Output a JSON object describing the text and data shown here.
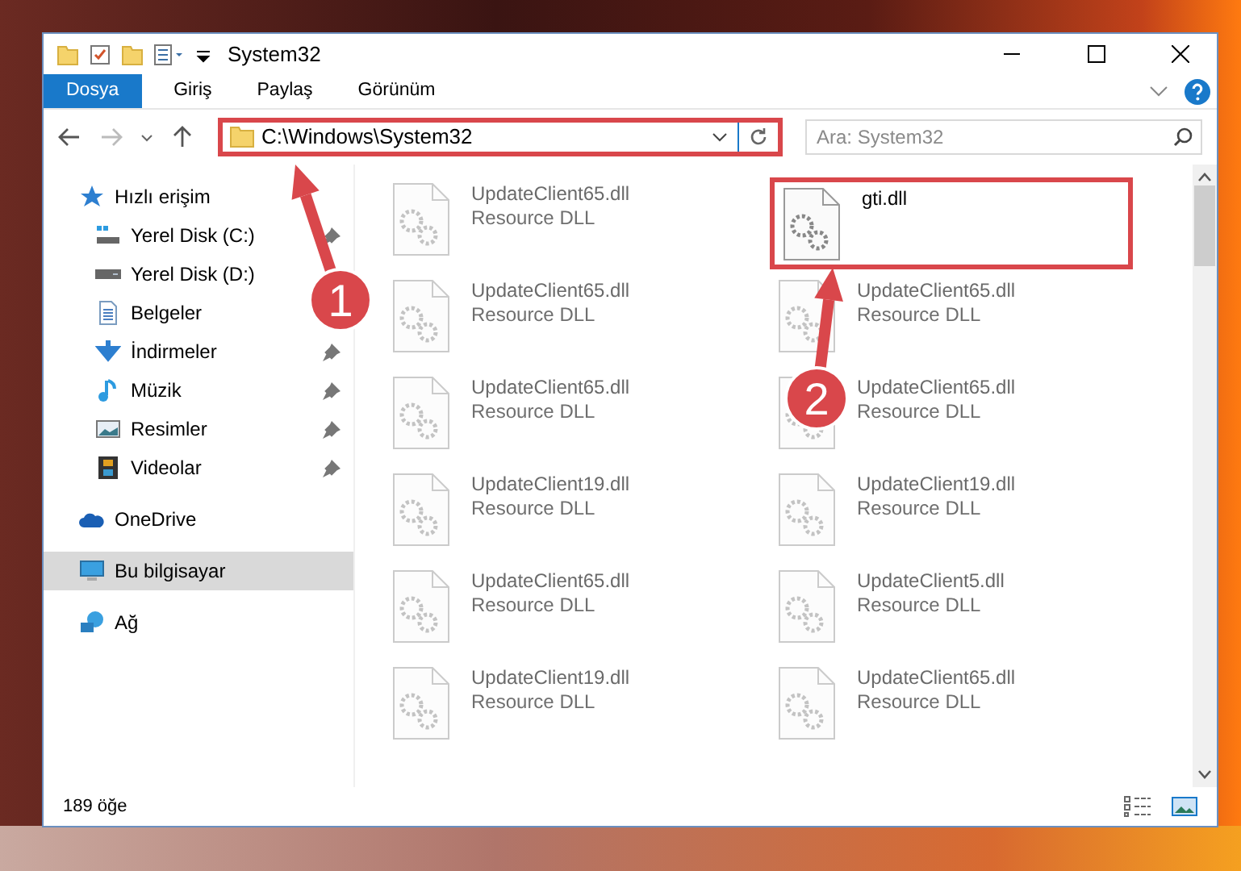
{
  "window": {
    "title": "System32"
  },
  "ribbon_tabs": [
    {
      "label": "Dosya",
      "selected": true
    },
    {
      "label": "Giriş",
      "selected": false
    },
    {
      "label": "Paylaş",
      "selected": false
    },
    {
      "label": "Görünüm",
      "selected": false
    }
  ],
  "address": {
    "path": "C:\\Windows\\System32",
    "highlighted": true
  },
  "search": {
    "placeholder": "Ara: System32"
  },
  "sidebar": {
    "items": [
      {
        "label": "Hızlı erişim",
        "kind": "star",
        "selected": false,
        "children": [
          {
            "label": "Yerel Disk (C:)",
            "kind": "drive-c",
            "pinned": true,
            "selected": false
          },
          {
            "label": "Yerel Disk (D:)",
            "kind": "drive",
            "pinned": false,
            "selected": false
          },
          {
            "label": "Belgeler",
            "kind": "document",
            "pinned": false,
            "selected": false
          },
          {
            "label": "İndirmeler",
            "kind": "download",
            "pinned": true,
            "selected": false
          },
          {
            "label": "Müzik",
            "kind": "music",
            "pinned": true,
            "selected": false
          },
          {
            "label": "Resimler",
            "kind": "picture",
            "pinned": true,
            "selected": false
          },
          {
            "label": "Videolar",
            "kind": "video",
            "pinned": true,
            "selected": false
          }
        ]
      },
      {
        "label": "OneDrive",
        "kind": "cloud",
        "selected": false
      },
      {
        "label": "Bu bilgisayar",
        "kind": "computer",
        "selected": true
      },
      {
        "label": "Ağ",
        "kind": "network",
        "selected": false
      }
    ]
  },
  "files": [
    {
      "name": "UpdateClient65.dll",
      "type": "Resource DLL",
      "blurred": true,
      "highlighted": false
    },
    {
      "name": "gti.dll",
      "blurred": false,
      "highlighted": true
    },
    {
      "name": "UpdateClient65.dll",
      "type": "Resource DLL",
      "blurred": true,
      "highlighted": false
    },
    {
      "name": "UpdateClient65.dll",
      "type": "Resource DLL",
      "blurred": true,
      "highlighted": false
    },
    {
      "name": "UpdateClient65.dll",
      "type": "Resource DLL",
      "blurred": true,
      "highlighted": false
    },
    {
      "name": "UpdateClient65.dll",
      "type": "Resource DLL",
      "blurred": true,
      "highlighted": false
    },
    {
      "name": "UpdateClient19.dll",
      "type": "Resource DLL",
      "blurred": true,
      "highlighted": false
    },
    {
      "name": "UpdateClient19.dll",
      "type": "Resource DLL",
      "blurred": true,
      "highlighted": false
    },
    {
      "name": "UpdateClient65.dll",
      "type": "Resource DLL",
      "blurred": true,
      "highlighted": false
    },
    {
      "name": "UpdateClient5.dll",
      "type": "Resource DLL",
      "blurred": true,
      "highlighted": false
    },
    {
      "name": "UpdateClient19.dll",
      "type": "Resource DLL",
      "blurred": true,
      "highlighted": false
    },
    {
      "name": "UpdateClient65.dll",
      "type": "Resource DLL",
      "blurred": true,
      "highlighted": false
    }
  ],
  "status_bar": {
    "count": "189 öğe"
  },
  "annotations": [
    {
      "label": "1"
    },
    {
      "label": "2"
    }
  ]
}
